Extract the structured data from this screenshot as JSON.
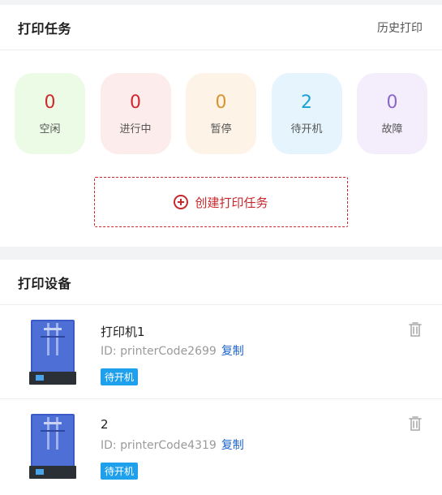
{
  "task_section": {
    "title": "打印任务",
    "history_link": "历史打印"
  },
  "statuses": [
    {
      "count": "0",
      "label": "空闲",
      "color": "#d0282c",
      "bg": "#ecfbe6"
    },
    {
      "count": "0",
      "label": "进行中",
      "color": "#d0282c",
      "bg": "#fdecec"
    },
    {
      "count": "0",
      "label": "暂停",
      "color": "#d9932f",
      "bg": "#fdf3e6"
    },
    {
      "count": "2",
      "label": "待开机",
      "color": "#1a9fd6",
      "bg": "#e6f5fd"
    },
    {
      "count": "0",
      "label": "故障",
      "color": "#8a67c8",
      "bg": "#f4eefc"
    }
  ],
  "create_task": {
    "label": "创建打印任务",
    "icon": "plus-circle-icon"
  },
  "device_section": {
    "title": "打印设备"
  },
  "devices": [
    {
      "name": "打印机1",
      "id_prefix": "ID: ",
      "id": "printerCode2699",
      "copy_label": "复制",
      "status": "待开机"
    },
    {
      "name": "2",
      "id_prefix": "ID: ",
      "id": "printerCode4319",
      "copy_label": "复制",
      "status": "待开机"
    }
  ],
  "colors": {
    "accent": "#c8282c",
    "link": "#1e63c8",
    "tag": "#1fa0ec"
  }
}
